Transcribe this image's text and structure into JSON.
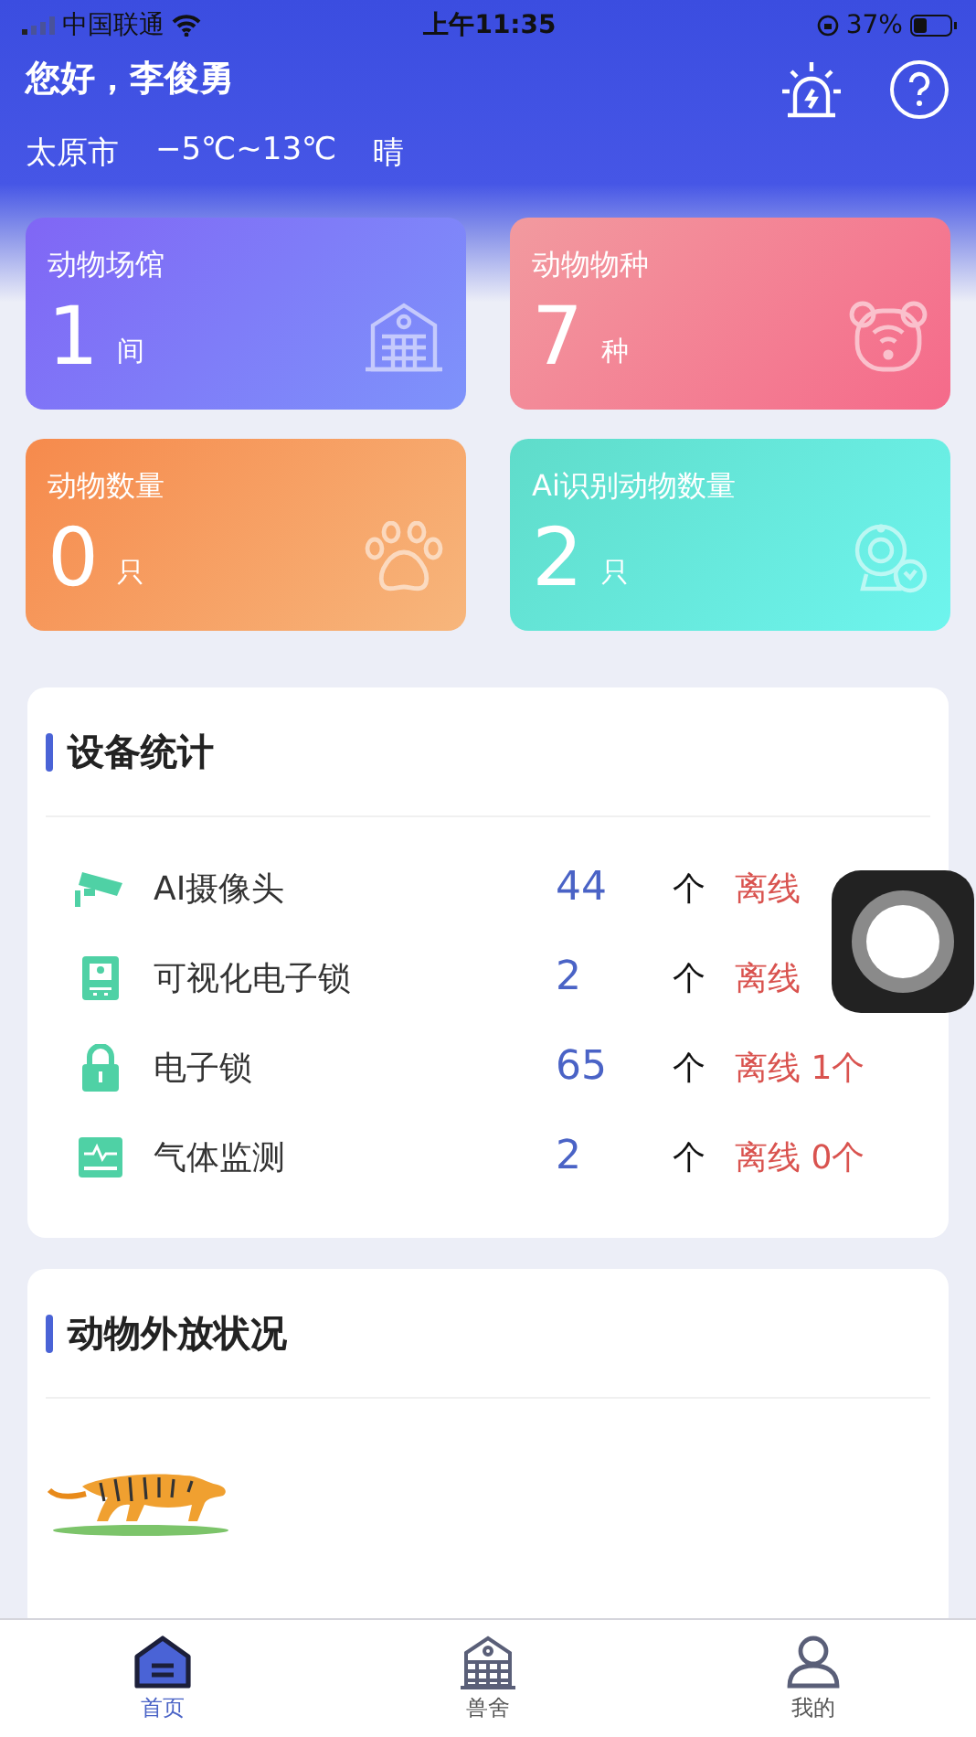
{
  "status_bar": {
    "carrier": "中国联通",
    "time": "上午11:35",
    "battery": "37%"
  },
  "header": {
    "greeting": "您好，李俊勇",
    "city": "太原市",
    "temperature": "−5℃~13℃",
    "weather": "晴"
  },
  "stat_cards": [
    {
      "kind": "venue",
      "title": "动物场馆",
      "value": "1",
      "unit": "间"
    },
    {
      "kind": "species",
      "title": "动物物种",
      "value": "7",
      "unit": "种"
    },
    {
      "kind": "count",
      "title": "动物数量",
      "value": "0",
      "unit": "只"
    },
    {
      "kind": "ai",
      "title": "Ai识别动物数量",
      "value": "2",
      "unit": "只"
    }
  ],
  "device_stats": {
    "title": "设备统计",
    "rows": [
      {
        "kind": "camera",
        "name": "AI摄像头",
        "count": "44",
        "unit": "个",
        "offline": "离线"
      },
      {
        "kind": "screen",
        "name": "可视化电子锁",
        "count": "2",
        "unit": "个",
        "offline": "离线"
      },
      {
        "kind": "lock",
        "name": "电子锁",
        "count": "65",
        "unit": "个",
        "offline": "离线 1个"
      },
      {
        "kind": "monitor",
        "name": "气体监测",
        "count": "2",
        "unit": "个",
        "offline": "离线 0个"
      }
    ]
  },
  "animal_release": {
    "title": "动物外放状况"
  },
  "tabs": [
    {
      "kind": "home",
      "label": "首页",
      "selected": true
    },
    {
      "kind": "house",
      "label": "兽舍",
      "selected": false
    },
    {
      "kind": "user",
      "label": "我的",
      "selected": false
    }
  ]
}
